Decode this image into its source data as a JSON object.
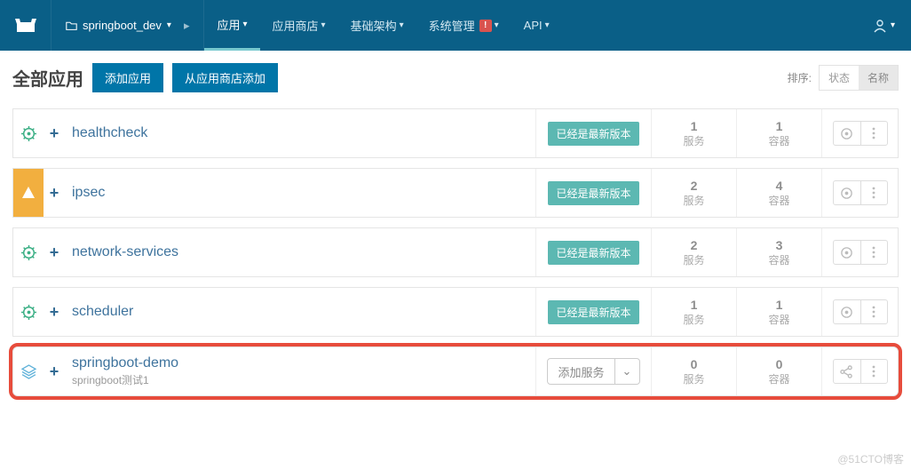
{
  "topbar": {
    "project_name": "springboot_dev",
    "nav": {
      "apps": "应用",
      "catalog": "应用商店",
      "infra": "基础架构",
      "admin": "系统管理",
      "api": "API"
    },
    "alert_badge": "!"
  },
  "page": {
    "title": "全部应用",
    "add_stack_btn": "添加应用",
    "add_from_catalog_btn": "从应用商店添加",
    "sort_label": "排序:",
    "sort_state": "状态",
    "sort_name": "名称"
  },
  "labels": {
    "version_latest": "已经是最新版本",
    "add_service": "添加服务",
    "services": "服务",
    "containers": "容器"
  },
  "stacks": [
    {
      "status": "ok",
      "name": "healthcheck",
      "desc": "",
      "version": "latest",
      "services": 1,
      "containers": 1,
      "action_icon": "gear"
    },
    {
      "status": "warn",
      "name": "ipsec",
      "desc": "",
      "version": "latest",
      "services": 2,
      "containers": 4,
      "action_icon": "gear"
    },
    {
      "status": "ok",
      "name": "network-services",
      "desc": "",
      "version": "latest",
      "services": 2,
      "containers": 3,
      "action_icon": "gear"
    },
    {
      "status": "ok",
      "name": "scheduler",
      "desc": "",
      "version": "latest",
      "services": 1,
      "containers": 1,
      "action_icon": "gear"
    },
    {
      "status": "user",
      "name": "springboot-demo",
      "desc": "springboot测试1",
      "version": "add",
      "services": 0,
      "containers": 0,
      "action_icon": "share",
      "highlight": true
    }
  ],
  "watermark": "@51CTO博客"
}
